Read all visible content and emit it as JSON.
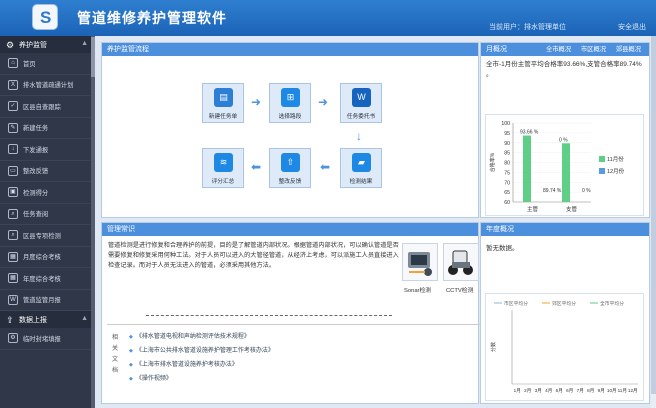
{
  "header": {
    "title": "管道维修养护管理软件",
    "user_label": "当前用户：排水管理单位",
    "logout": "安全退出"
  },
  "sidebar": {
    "sections": [
      {
        "title": "养护监管",
        "items": [
          "首页",
          "排水管道疏通计划",
          "区县自查跟踪",
          "新建任务",
          "下发通报",
          "整改反馈",
          "检测得分",
          "任务查阅",
          "区县专项检测",
          "月度综合考核",
          "年度综合考核",
          "管道监管月报"
        ]
      },
      {
        "title": "数据上报",
        "items": [
          "临时封堵填报"
        ]
      }
    ]
  },
  "flow": {
    "title": "养护监管流程",
    "nodes": [
      "新建任务单",
      "选择路段",
      "任务委托书",
      "检测结果",
      "整改反馈",
      "评分汇总"
    ]
  },
  "monthly": {
    "title": "月概况",
    "links": [
      "全市概况",
      "市区概况",
      "郊县概况"
    ],
    "summary": "全市-1月份主管平均合格率93.66%,支管合格率89.74% 。"
  },
  "practice": {
    "title": "管理常识",
    "text": "管道检测是进行修复和合理养护的前提，目的是了解管道内部状况。根据管道内部状况，可以确认管道是否需要修复和修复采用何种工法。对于人员可以进入的大管径管道，从经济上考虑，可以派施工人员直接进入检查记录。而对于人员无法进入的管道，必须采用其他方法。",
    "tools": [
      "Sonar检测",
      "CCTV检测"
    ],
    "docs_label": "相关文档",
    "docs": [
      "《排水管道电视和声纳检测评估技术规程》",
      "《上海市公共排水管道设施养护管理工作考核办法》",
      "《上海市排水管道设施养护考核办法》",
      "《操作视频》"
    ]
  },
  "annual": {
    "title": "年度概况",
    "empty": "暂无数据。"
  },
  "colors": {
    "accent": "#4c8fdc",
    "bar_nov": "#5fcf87",
    "bar_dec": "#5b9bdd"
  },
  "chart_data": [
    {
      "type": "bar",
      "categories": [
        "主管",
        "支管"
      ],
      "series": [
        {
          "name": "11月份",
          "values": [
            93.66,
            89.74
          ]
        },
        {
          "name": "12月份",
          "values": [
            0,
            0
          ]
        }
      ],
      "data_labels": [
        "93.66 %",
        "89.74 %",
        "0 %",
        "0 %"
      ],
      "ylabel": "合格率%",
      "ylim": [
        60,
        100
      ],
      "yticks": [
        60,
        65,
        70,
        75,
        80,
        85,
        90,
        95,
        100
      ]
    },
    {
      "type": "line",
      "categories": [
        "1月",
        "2月",
        "3月",
        "4月",
        "5月",
        "6月",
        "7月",
        "8月",
        "9月",
        "10月",
        "11月",
        "12月"
      ],
      "series": [
        {
          "name": "市区平均分",
          "values": []
        },
        {
          "name": "郊区平均分",
          "values": []
        },
        {
          "name": "全市平均分",
          "values": []
        }
      ],
      "ylabel": "分数"
    }
  ]
}
